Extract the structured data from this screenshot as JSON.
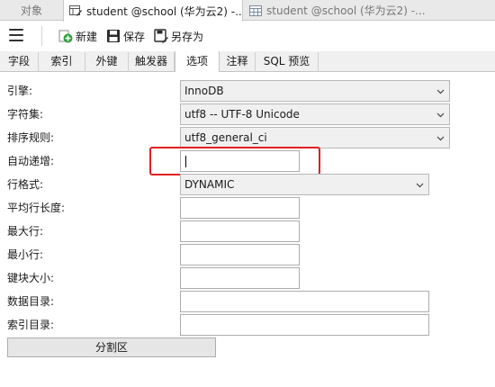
{
  "window_tabs": [
    {
      "label": "对象",
      "active": false
    },
    {
      "label": "student @school (华为云2) -...",
      "active": true,
      "icon": "table-edit-icon"
    },
    {
      "label": "student @school (华为云2) -...",
      "active": false,
      "icon": "table-icon"
    }
  ],
  "toolbar": {
    "menu_icon": "hamburger-icon",
    "new_label": "新建",
    "save_label": "保存",
    "save_as_label": "另存为"
  },
  "sub_tabs": [
    {
      "label": "字段",
      "active": false
    },
    {
      "label": "索引",
      "active": false
    },
    {
      "label": "外键",
      "active": false
    },
    {
      "label": "触发器",
      "active": false
    },
    {
      "label": "选项",
      "active": true
    },
    {
      "label": "注释",
      "active": false
    },
    {
      "label": "SQL 预览",
      "active": false
    }
  ],
  "options": {
    "engine": {
      "label": "引擎:",
      "value": "InnoDB"
    },
    "charset": {
      "label": "字符集:",
      "value": "utf8 -- UTF-8 Unicode"
    },
    "collation": {
      "label": "排序规则:",
      "value": "utf8_general_ci"
    },
    "auto_increment": {
      "label": "自动递增:",
      "value": ""
    },
    "row_format": {
      "label": "行格式:",
      "value": "DYNAMIC"
    },
    "avg_row_length": {
      "label": "平均行长度:",
      "value": ""
    },
    "max_rows": {
      "label": "最大行:",
      "value": ""
    },
    "min_rows": {
      "label": "最小行:",
      "value": ""
    },
    "key_block_size": {
      "label": "键块大小:",
      "value": ""
    },
    "data_directory": {
      "label": "数据目录:",
      "value": ""
    },
    "index_directory": {
      "label": "索引目录:",
      "value": ""
    }
  },
  "partition_button": "分割区",
  "colors": {
    "highlight": "#e02020",
    "new_icon_green": "#2e9e3e"
  }
}
